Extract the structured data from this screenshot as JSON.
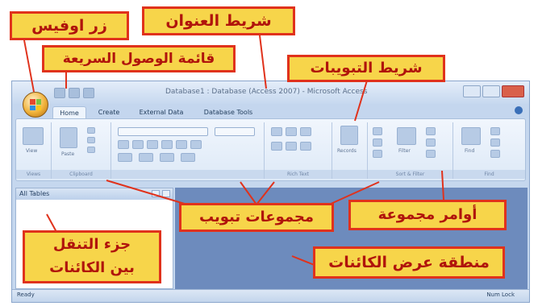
{
  "window": {
    "title": "Database1 : Database (Access 2007) - Microsoft Access",
    "tabs": [
      "Home",
      "Create",
      "External Data",
      "Database Tools"
    ],
    "active_tab": "Home"
  },
  "ribbon": {
    "groups": [
      {
        "label": "Views",
        "buttons": [
          "View"
        ]
      },
      {
        "label": "Clipboard",
        "buttons": [
          "Paste"
        ]
      },
      {
        "label": "Font",
        "buttons": []
      },
      {
        "label": "Rich Text",
        "buttons": []
      },
      {
        "label": "",
        "buttons": [
          "Records"
        ]
      },
      {
        "label": "Sort & Filter",
        "buttons": [
          "Filter"
        ]
      },
      {
        "label": "Find",
        "buttons": [
          "Find"
        ]
      }
    ]
  },
  "nav_pane": {
    "header": "All Tables"
  },
  "status_bar": {
    "left": "Ready",
    "right": "Num Lock"
  },
  "callouts": {
    "office_button": "زر اوفيس",
    "title_bar": "شريط العنوان",
    "quick_access": "قائمة الوصول السريعة",
    "tabs_bar": "شريط التبويبات",
    "tab_groups": "مجموعات تبويب",
    "group_commands": "أوامر مجموعة",
    "nav_pane_line1": "جزء التنقل",
    "nav_pane_line2": "بين الكائنات",
    "object_area": "منطقة عرض الكائنات"
  },
  "colors": {
    "callout_fill": "#f7d54a",
    "callout_border": "#e0321c",
    "callout_text": "#b0140c",
    "workspace": "#6d8bbd"
  }
}
